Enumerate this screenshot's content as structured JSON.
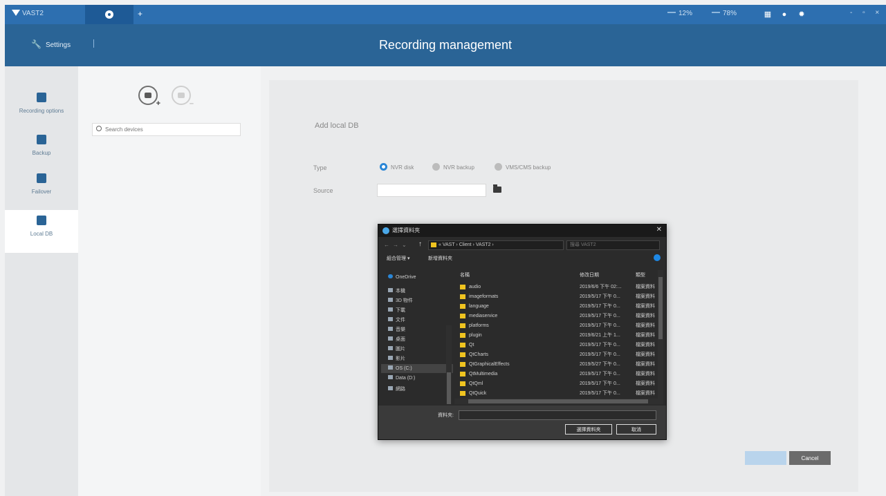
{
  "titlebar": {
    "app_name": "VAST2",
    "stats": [
      "12%",
      "78%"
    ],
    "window_controls": "- ▫ ×"
  },
  "header": {
    "settings_label": "Settings",
    "page_title": "Recording management"
  },
  "sidebar": {
    "items": [
      {
        "label": "Recording options",
        "icon": "calendar-icon"
      },
      {
        "label": "Backup",
        "icon": "backup-icon"
      },
      {
        "label": "Failover",
        "icon": "failover-icon"
      },
      {
        "label": "Local DB",
        "icon": "local-db-icon"
      }
    ],
    "active_index": 3
  },
  "devices": {
    "search_placeholder": "Search devices"
  },
  "form": {
    "title": "Add local DB",
    "type_label": "Type",
    "type_options": [
      "NVR disk",
      "NVR backup",
      "VMS/CMS backup"
    ],
    "type_selected": "NVR disk",
    "source_label": "Source",
    "source_value": "",
    "ok_label": "",
    "cancel_label": "Cancel"
  },
  "dialog": {
    "title": "選擇資料夾",
    "path": "« VAST › Client › VAST2 ›",
    "search_placeholder": "搜尋 VAST2",
    "toolbar": [
      "組合管理 ▾",
      "新增資料夾"
    ],
    "nav": [
      "OneDrive",
      "本機",
      "3D 物件",
      "下載",
      "文件",
      "音樂",
      "桌面",
      "圖片",
      "影片",
      "OS (C:)",
      "Data (D:)",
      "網路"
    ],
    "nav_selected_index": 9,
    "columns": [
      "名稱",
      "修改日期",
      "類型"
    ],
    "files": [
      {
        "name": "audio",
        "date": "2019/6/6 下午 02:...",
        "type": "檔案資料"
      },
      {
        "name": "imageformats",
        "date": "2019/5/17 下午 0...",
        "type": "檔案資料"
      },
      {
        "name": "language",
        "date": "2019/5/17 下午 0...",
        "type": "檔案資料"
      },
      {
        "name": "mediaservice",
        "date": "2019/5/17 下午 0...",
        "type": "檔案資料"
      },
      {
        "name": "platforms",
        "date": "2019/5/17 下午 0...",
        "type": "檔案資料"
      },
      {
        "name": "plugin",
        "date": "2019/6/21 上午 1...",
        "type": "檔案資料"
      },
      {
        "name": "Qt",
        "date": "2019/5/17 下午 0...",
        "type": "檔案資料"
      },
      {
        "name": "QtCharts",
        "date": "2019/5/17 下午 0...",
        "type": "檔案資料"
      },
      {
        "name": "QtGraphicalEffects",
        "date": "2019/5/27 下午 0...",
        "type": "檔案資料"
      },
      {
        "name": "QtMultimedia",
        "date": "2019/5/17 下午 0...",
        "type": "檔案資料"
      },
      {
        "name": "QtQml",
        "date": "2019/5/17 下午 0...",
        "type": "檔案資料"
      },
      {
        "name": "QtQuick",
        "date": "2019/5/17 下午 0...",
        "type": "檔案資料"
      }
    ],
    "folder_label": "資料夾:",
    "folder_value": "",
    "select_label": "選擇資料夾",
    "cancel_label": "取消"
  }
}
